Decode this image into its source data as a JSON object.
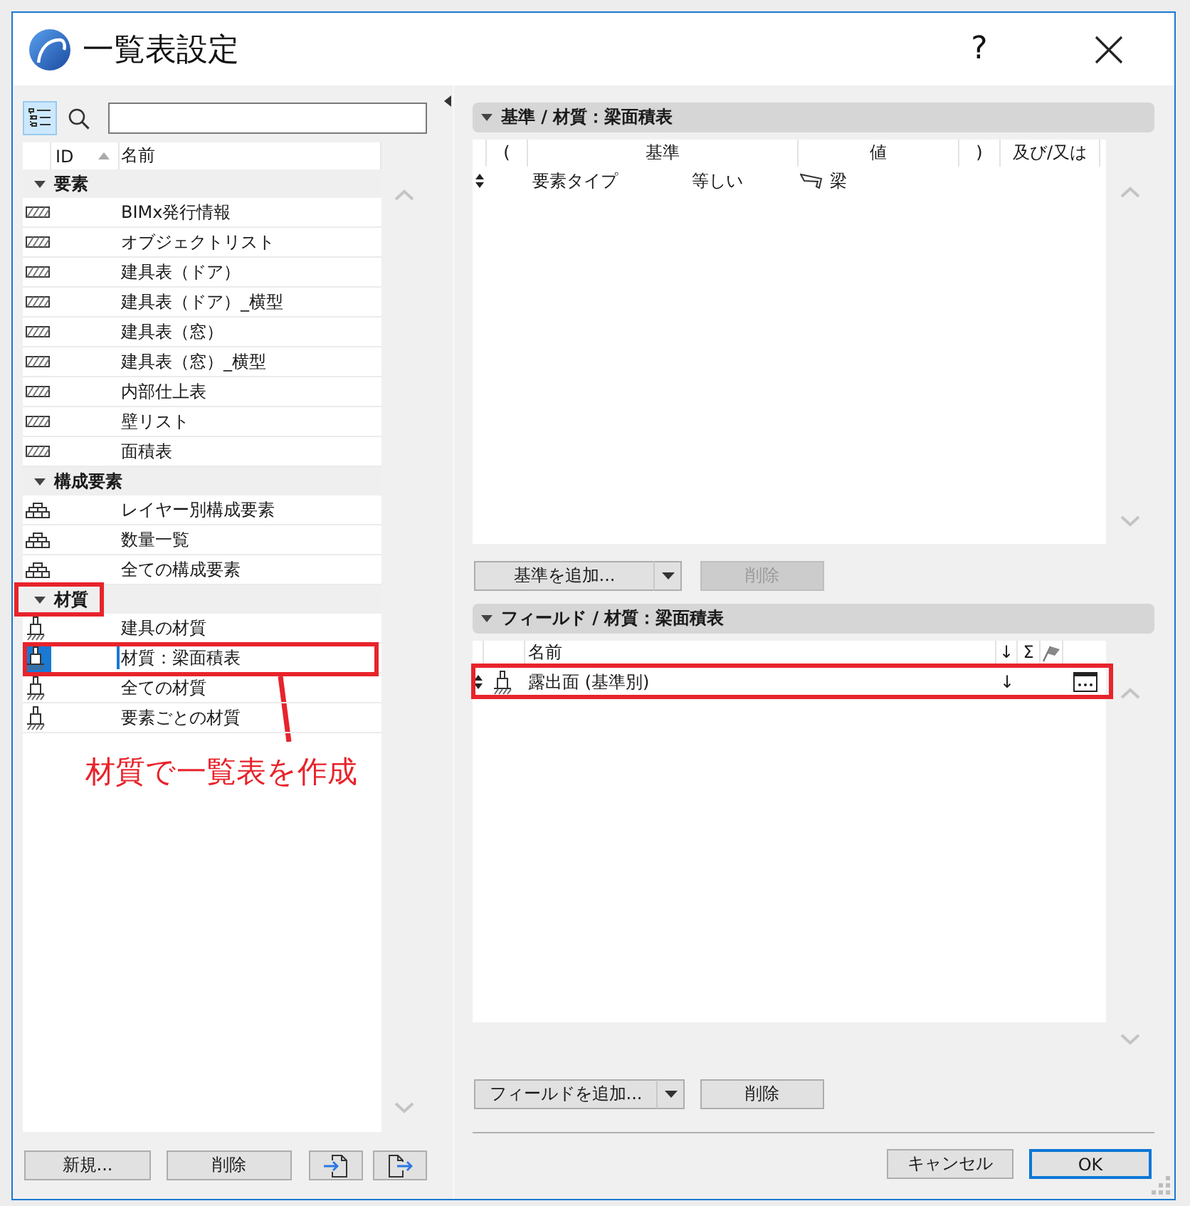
{
  "window": {
    "title": "一覧表設定",
    "help": "?"
  },
  "left_panel": {
    "tree_view_button": {
      "selected": true
    },
    "list": {
      "columns": [
        {
          "label": "ID",
          "sorted": true
        },
        {
          "label": "名前",
          "sorted": false
        }
      ],
      "groups": [
        {
          "label": "要素",
          "kind": "element",
          "expanded": true,
          "highlighted": false,
          "items": [
            {
              "label": "BIMx発行情報",
              "selected": false,
              "highlighted": false
            },
            {
              "label": "オブジェクトリスト",
              "selected": false,
              "highlighted": false
            },
            {
              "label": "建具表（ドア）",
              "selected": false,
              "highlighted": false
            },
            {
              "label": "建具表（ドア）_横型",
              "selected": false,
              "highlighted": false
            },
            {
              "label": "建具表（窓）",
              "selected": false,
              "highlighted": false
            },
            {
              "label": "建具表（窓）_横型",
              "selected": false,
              "highlighted": false
            },
            {
              "label": "内部仕上表",
              "selected": false,
              "highlighted": false
            },
            {
              "label": "壁リスト",
              "selected": false,
              "highlighted": false
            },
            {
              "label": "面積表",
              "selected": false,
              "highlighted": false
            }
          ]
        },
        {
          "label": "構成要素",
          "kind": "component",
          "expanded": true,
          "highlighted": false,
          "items": [
            {
              "label": "レイヤー別構成要素",
              "selected": false,
              "highlighted": false
            },
            {
              "label": "数量一覧",
              "selected": false,
              "highlighted": false
            },
            {
              "label": "全ての構成要素",
              "selected": false,
              "highlighted": false
            }
          ]
        },
        {
          "label": "材質",
          "kind": "surface",
          "expanded": true,
          "highlighted": true,
          "items": [
            {
              "label": "建具の材質",
              "selected": false,
              "highlighted": false
            },
            {
              "label": "材質：梁面積表",
              "selected": true,
              "highlighted": true,
              "callout": "材質で一覧表を作成"
            },
            {
              "label": "全ての材質",
              "selected": false,
              "highlighted": false
            },
            {
              "label": "要素ごとの材質",
              "selected": false,
              "highlighted": false
            }
          ]
        }
      ]
    },
    "buttons": [
      {
        "label": "新規..."
      },
      {
        "label": "削除"
      }
    ]
  },
  "criteria": {
    "title": "基準 / 材質：梁面積表",
    "expanded": true,
    "columns": [
      "(",
      "基準",
      "値",
      ")",
      "及び/又は"
    ],
    "rows": [
      {
        "criterion": "要素タイプ",
        "operator": "等しい",
        "value": "梁"
      }
    ],
    "add_button": "基準を追加...",
    "delete_button": {
      "label": "削除",
      "disabled": true
    }
  },
  "fields": {
    "title": "フィールド / 材質：梁面積表",
    "expanded": true,
    "columns": [
      "名前",
      "↓",
      "Σ"
    ],
    "rows": [
      {
        "name": "露出面 (基準別)",
        "sort": "↓",
        "highlighted": true
      }
    ],
    "add_button": "フィールドを追加...",
    "delete_button": {
      "label": "削除",
      "disabled": false
    }
  },
  "footer": {
    "buttons": [
      {
        "label": "キャンセル",
        "default": false
      },
      {
        "label": "OK",
        "default": true
      }
    ]
  }
}
